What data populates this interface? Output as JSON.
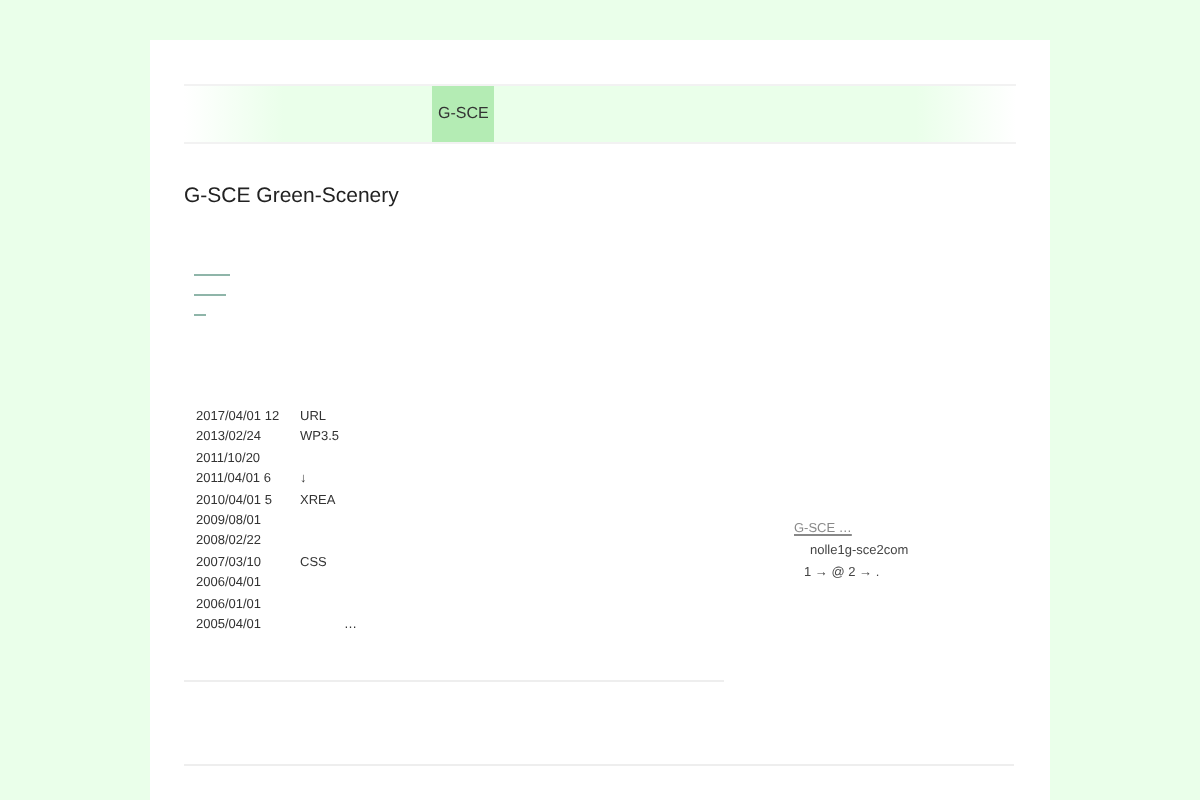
{
  "nav": {
    "tabs": [
      {
        "label": "G-SCE",
        "selected": true
      }
    ]
  },
  "site_title": "G-SCE Green-Scenery",
  "history": [
    {
      "date": "2017/04/01 12",
      "note": "URL"
    },
    {
      "date": "2013/02/24",
      "note": "WP3.5"
    },
    {
      "date": "2011/10/20"
    },
    {
      "date": "2011/04/01 6",
      "note": "↓"
    },
    {
      "date": "2010/04/01 5",
      "note": "XREA"
    },
    {
      "date": "2009/08/01"
    },
    {
      "date": "2008/02/22"
    },
    {
      "date": "2007/03/10",
      "note": "CSS"
    },
    {
      "date": "2006/04/01"
    },
    {
      "date": "2006/01/01"
    },
    {
      "date": "2005/04/01",
      "note": "…"
    }
  ],
  "sidebar": {
    "link": "G-SCE …",
    "lines": [
      "nolle1g-sce2com",
      "1 → @   2 → ."
    ]
  }
}
